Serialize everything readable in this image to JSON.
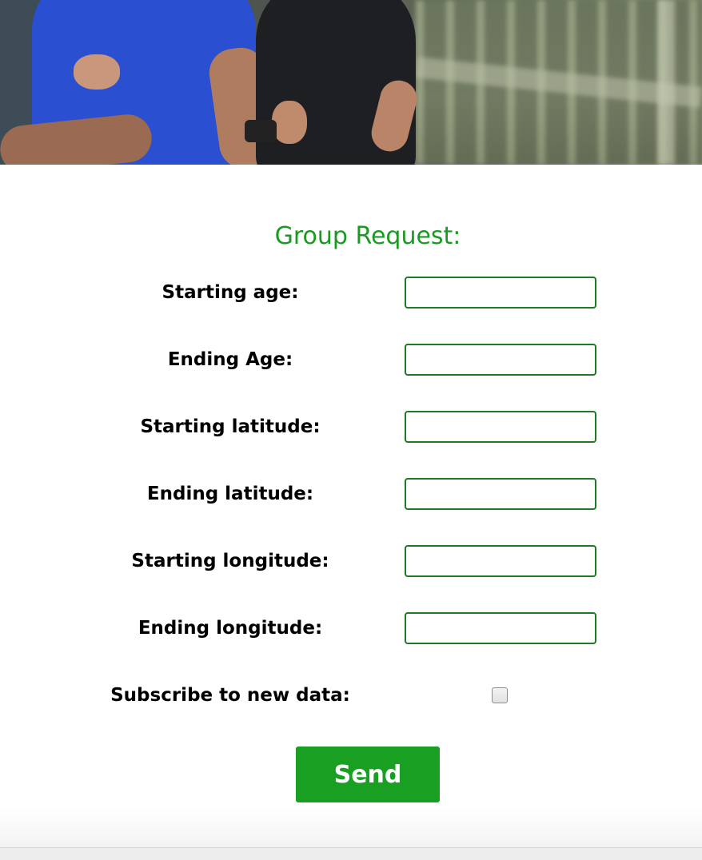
{
  "hero": {
    "image": "runners-photo"
  },
  "form": {
    "title": "Group Request:",
    "fields": [
      {
        "label": "Starting age:",
        "value": ""
      },
      {
        "label": "Ending Age:",
        "value": ""
      },
      {
        "label": "Starting latitude:",
        "value": ""
      },
      {
        "label": "Ending latitude:",
        "value": ""
      },
      {
        "label": "Starting longitude:",
        "value": ""
      },
      {
        "label": "Ending longitude:",
        "value": ""
      }
    ],
    "subscribe": {
      "label": "Subscribe to new data:",
      "checked": false
    },
    "submit_label": "Send"
  },
  "colors": {
    "accent": "#1a9a22",
    "button": "#19a023",
    "input_border": "#1f7a24"
  }
}
